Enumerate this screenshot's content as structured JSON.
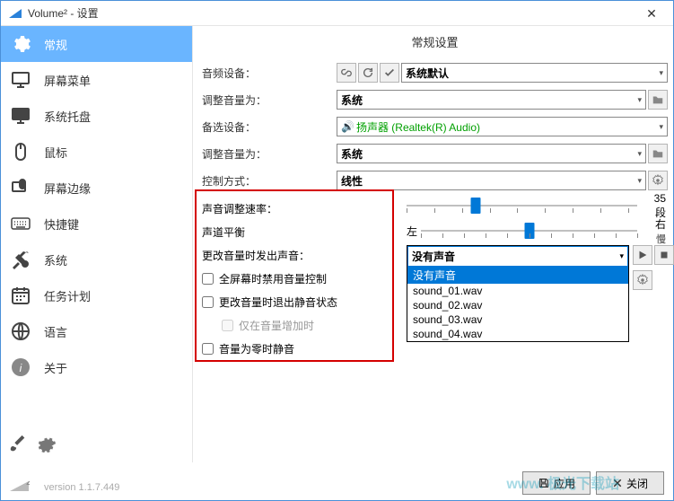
{
  "window": {
    "title": "Volume² - 设置",
    "close": "✕"
  },
  "sidebar": {
    "items": [
      {
        "label": "常规"
      },
      {
        "label": "屏幕菜单"
      },
      {
        "label": "系统托盘"
      },
      {
        "label": "鼠标"
      },
      {
        "label": "屏幕边缘"
      },
      {
        "label": "快捷键"
      },
      {
        "label": "系统"
      },
      {
        "label": "任务计划"
      },
      {
        "label": "语言"
      },
      {
        "label": "关于"
      }
    ]
  },
  "page": {
    "heading": "常规设置",
    "labels": {
      "audio_device": "音频设备：",
      "adjust_volume_for_1": "调整音量为：",
      "alt_device": "备选设备：",
      "adjust_volume_for_2": "调整音量为：",
      "control_method": "控制方式：",
      "rate": "声音调整速率：",
      "balance": "声道平衡",
      "sound_on_change": "更改音量时发出声音：",
      "cb_fullscreen": "全屏幕时禁用音量控制",
      "cb_exit_mute": "更改音量时退出静音状态",
      "cb_only_increase": "仅在音量增加时",
      "cb_zero_mute": "音量为零时静音",
      "left": "左",
      "right": "右",
      "steps_value": "35",
      "steps_unit": "段",
      "slow": "慢"
    },
    "values": {
      "audio_device": "系统默认",
      "adjust1": "系统",
      "alt_device_icon": "🔊",
      "alt_device": "扬声器 (Realtek(R) Audio)",
      "adjust2": "系统",
      "control_method": "线性",
      "sound_select": "没有声音"
    },
    "dropdown": {
      "options": [
        "没有声音",
        "sound_01.wav",
        "sound_02.wav",
        "sound_03.wav",
        "sound_04.wav"
      ],
      "highlighted": 0
    }
  },
  "footer": {
    "version": "version 1.1.7.449",
    "apply": "应用",
    "close": "关闭"
  },
  "watermark": "www. 极光下载站"
}
